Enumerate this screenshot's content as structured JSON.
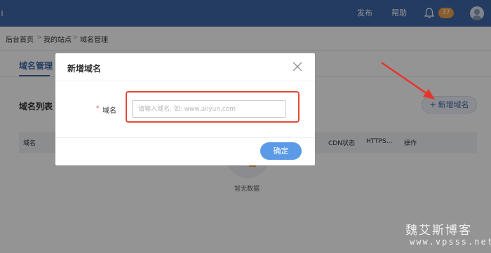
{
  "topbar": {
    "publish_label": "发布",
    "help_label": "帮助",
    "notification_count": "37"
  },
  "breadcrumb": [
    "后台首页",
    "我的站点",
    "域名管理"
  ],
  "page": {
    "tab_label": "域名管理",
    "list_title": "域名列表",
    "add_button_label": "新增域名",
    "table_columns": [
      "域名",
      "CDN状态",
      "HTTPS...",
      "操作"
    ],
    "empty_text": "暂无数据"
  },
  "dialog": {
    "title": "新增域名",
    "required_mark": "*",
    "field_label": "域名",
    "input_value": "",
    "input_placeholder": "请输入域名, 如: www.aliyun.com",
    "confirm_label": "确定"
  },
  "watermark": {
    "line1": "魏艾斯博客",
    "line2": "www.vpsss.net"
  },
  "colors": {
    "topbar": "#3f68a9",
    "accent": "#3f68a9",
    "confirm": "#5b9ae6",
    "highlight": "#e34b35",
    "badge": "#f0a04b"
  }
}
